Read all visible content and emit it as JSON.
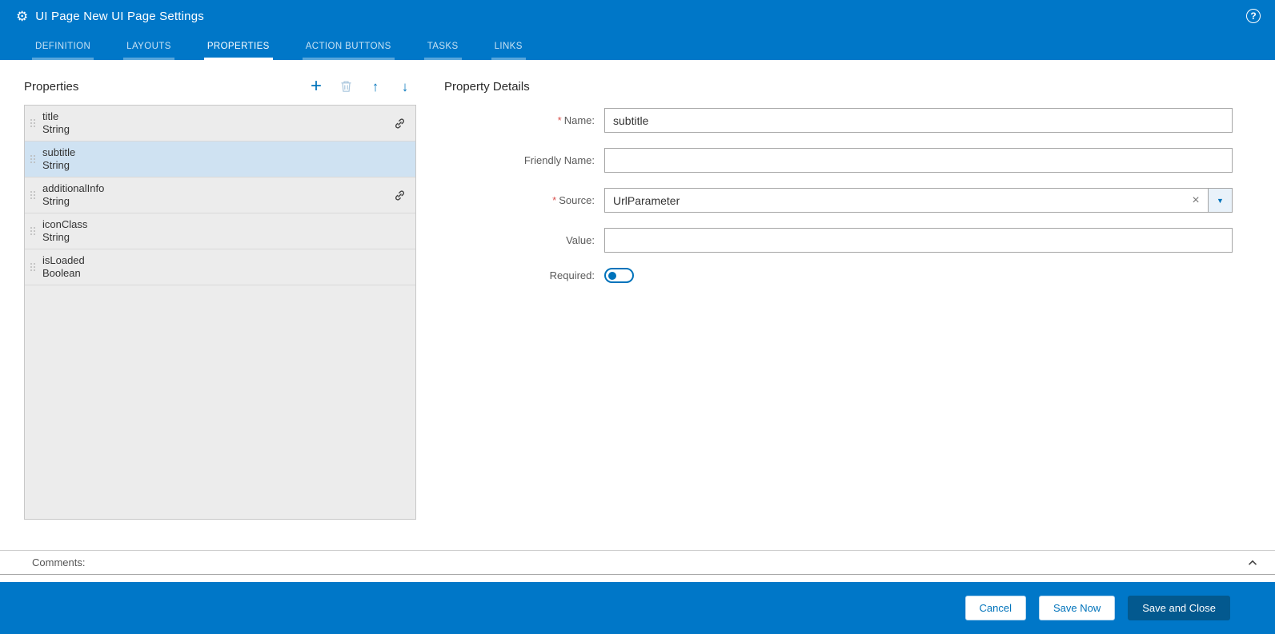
{
  "header": {
    "title": "UI Page New UI Page Settings"
  },
  "icons": {
    "gear": "⚙",
    "help": "?",
    "add": "+",
    "delete": "trash-icon",
    "move_up": "↑",
    "move_down": "↓",
    "link": "link-icon",
    "clear": "×",
    "caret_down": "▼",
    "collapse": "chevron-up-icon",
    "drag_handle": "drag-dots"
  },
  "tabs": [
    {
      "label": "DEFINITION",
      "active": false
    },
    {
      "label": "LAYOUTS",
      "active": false
    },
    {
      "label": "PROPERTIES",
      "active": true
    },
    {
      "label": "ACTION BUTTONS",
      "active": false
    },
    {
      "label": "TASKS",
      "active": false
    },
    {
      "label": "LINKS",
      "active": false
    }
  ],
  "properties_panel": {
    "title": "Properties",
    "items": [
      {
        "name": "title",
        "type": "String",
        "linked": true,
        "selected": false
      },
      {
        "name": "subtitle",
        "type": "String",
        "linked": false,
        "selected": true
      },
      {
        "name": "additionalInfo",
        "type": "String",
        "linked": true,
        "selected": false
      },
      {
        "name": "iconClass",
        "type": "String",
        "linked": false,
        "selected": false
      },
      {
        "name": "isLoaded",
        "type": "Boolean",
        "linked": false,
        "selected": false
      }
    ]
  },
  "details": {
    "title": "Property Details",
    "required_marker": "*",
    "name": {
      "label": "Name:",
      "required": true,
      "value": "subtitle"
    },
    "friendly_name": {
      "label": "Friendly Name:",
      "required": false,
      "value": ""
    },
    "source": {
      "label": "Source:",
      "required": true,
      "value": "UrlParameter"
    },
    "value": {
      "label": "Value:",
      "required": false,
      "value": ""
    },
    "required_field": {
      "label": "Required:",
      "state": "off"
    }
  },
  "comments": {
    "label": "Comments:"
  },
  "footer": {
    "buttons": [
      {
        "label": "Cancel",
        "style": "secondary"
      },
      {
        "label": "Save Now",
        "style": "secondary"
      },
      {
        "label": "Save and Close",
        "style": "primary"
      }
    ]
  },
  "colors": {
    "header_blue": "#0077c8",
    "accent": "#0073bb",
    "selected_row": "#cfe2f2",
    "primary_button": "#03598f",
    "required_marker": "#d9534f"
  }
}
